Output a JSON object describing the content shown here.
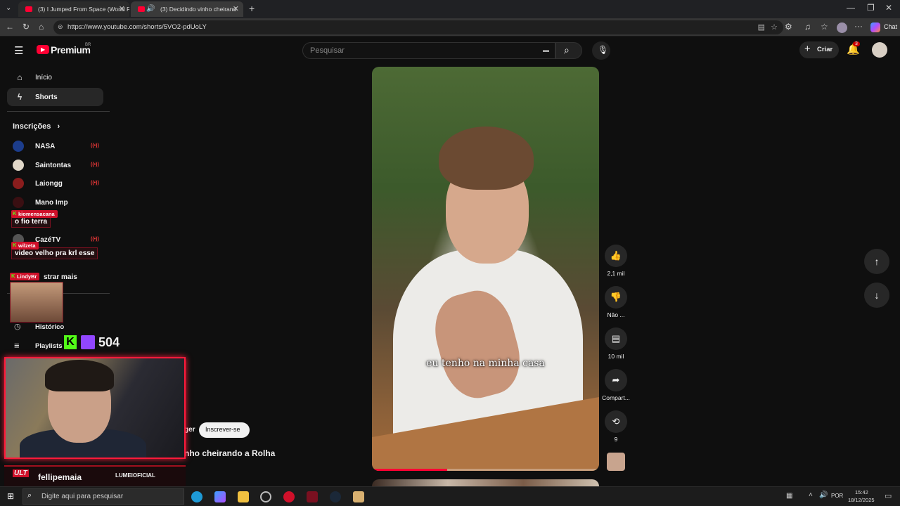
{
  "browser": {
    "tabs": [
      {
        "title": "(3) I Jumped From Space (World R"
      },
      {
        "title": "(3) Decidindo vinho cheirand"
      }
    ],
    "url": "https://www.youtube.com/shorts/5VO2-pdUoLY",
    "chat_label": "Chat"
  },
  "youtube": {
    "logo": "Premium",
    "logo_region": "BR",
    "search_placeholder": "Pesquisar",
    "create_label": "Criar",
    "notification_count": "3",
    "sidebar": {
      "nav": [
        {
          "label": "Início",
          "icon": "home-icon"
        },
        {
          "label": "Shorts",
          "icon": "shorts-icon"
        }
      ],
      "subscriptions_title": "Inscrições",
      "subscriptions": [
        {
          "name": "NASA"
        },
        {
          "name": "Saintontas"
        },
        {
          "name": "Laiongg"
        },
        {
          "name": "Mano Imp"
        },
        {
          "name": "CazéTV"
        }
      ],
      "show_more": "strar mais",
      "history": "Histórico",
      "playlists": "Playlists"
    },
    "video": {
      "caption": "eu tenho na minha casa",
      "progress": 0.33,
      "subscribe_label": "Inscrever-se",
      "channel_fragment": "ger",
      "title_fragment": "nho cheirando a Rolha"
    },
    "actions": [
      {
        "label": "2,1 mil",
        "icon": "like-icon"
      },
      {
        "label": "Não ...",
        "icon": "dislike-icon"
      },
      {
        "label": "10 mil",
        "icon": "comment-icon"
      },
      {
        "label": "Compart...",
        "icon": "share-icon"
      },
      {
        "label": "9",
        "icon": "remix-icon"
      }
    ]
  },
  "stream_overlay": {
    "chat": [
      {
        "user": "kiomensacana",
        "message": "o fio terra"
      },
      {
        "user": "wilzeta",
        "message": "video velho pra krl esse"
      },
      {
        "user": "LindyBr",
        "message": ""
      }
    ],
    "viewer_count": "504",
    "streamer_name": "fellipemaia",
    "sponsor": "LUMEIOFICIAL"
  },
  "taskbar": {
    "search_placeholder": "Digite aqui para pesquisar",
    "lang": "POR",
    "time": "15:42",
    "date": "18/12/2025"
  }
}
